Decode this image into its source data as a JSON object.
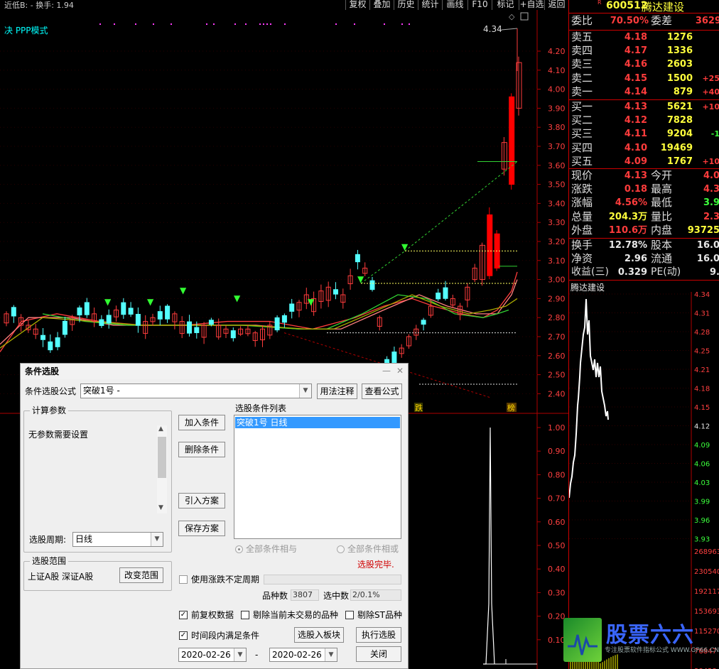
{
  "toolbar": {
    "title_text": "近低B: -  换手: 1.94",
    "mode_text": "决 PPP模式",
    "buttons": [
      "复权",
      "叠加",
      "历史",
      "统计",
      "画线",
      "F10",
      "标记",
      "+自选",
      "返回"
    ]
  },
  "chart_labels": {
    "high_marker": "4.34",
    "price_ticks": [
      "4.20",
      "4.10",
      "4.00",
      "3.90",
      "3.80",
      "3.70",
      "3.60",
      "3.50",
      "3.40",
      "3.30",
      "3.20",
      "3.10",
      "3.00",
      "2.90",
      "2.80",
      "2.70",
      "2.60",
      "2.50",
      "2.40"
    ],
    "volume_ticks": [
      "1.00",
      "0.90",
      "0.80",
      "0.70",
      "0.60",
      "0.50",
      "0.40",
      "0.30",
      "0.20",
      "0.10"
    ],
    "tag_die": "跌",
    "tag_bang": "榜"
  },
  "quote": {
    "stock_code": "600512",
    "stock_name": "腾达建设",
    "r_mark": "R",
    "weibi_label": "委比",
    "weibi_value": "70.50%",
    "weicha_label": "委差",
    "weicha_value": "3629",
    "asks": [
      {
        "label": "卖五",
        "price": "4.18",
        "volume": "1276",
        "change": ""
      },
      {
        "label": "卖四",
        "price": "4.17",
        "volume": "1336",
        "change": ""
      },
      {
        "label": "卖三",
        "price": "4.16",
        "volume": "2603",
        "change": ""
      },
      {
        "label": "卖二",
        "price": "4.15",
        "volume": "1500",
        "change": "+25"
      },
      {
        "label": "卖一",
        "price": "4.14",
        "volume": "879",
        "change": "+40"
      }
    ],
    "bids": [
      {
        "label": "买一",
        "price": "4.13",
        "volume": "5621",
        "change": "+10"
      },
      {
        "label": "买二",
        "price": "4.12",
        "volume": "7828",
        "change": ""
      },
      {
        "label": "买三",
        "price": "4.11",
        "volume": "9204",
        "change": "-1"
      },
      {
        "label": "买四",
        "price": "4.10",
        "volume": "19469",
        "change": ""
      },
      {
        "label": "买五",
        "price": "4.09",
        "volume": "1767",
        "change": "+10"
      }
    ],
    "stats": [
      {
        "l1": "现价",
        "v1": "4.13",
        "l2": "今开",
        "v2": "4.0"
      },
      {
        "l1": "涨跌",
        "v1": "0.18",
        "l2": "最高",
        "v2": "4.3"
      },
      {
        "l1": "涨幅",
        "v1": "4.56%",
        "l2": "最低",
        "v2": "3.9"
      },
      {
        "l1": "总量",
        "v1": "204.3万",
        "l2": "量比",
        "v2": "2.3"
      },
      {
        "l1": "外盘",
        "v1": "110.6万",
        "l2": "内盘",
        "v2": "93725"
      }
    ],
    "stats2": [
      {
        "l1": "换手",
        "v1": "12.78%",
        "l2": "股本",
        "v2": "16.0"
      },
      {
        "l1": "净资",
        "v1": "2.96",
        "l2": "流通",
        "v2": "16.0"
      },
      {
        "l1": "收益(三)",
        "v1": "0.329",
        "l2": "PE(动)",
        "v2": "9."
      }
    ],
    "mini_title": "腾达建设",
    "mini_price_ticks": [
      "4.34",
      "4.31",
      "4.28",
      "4.25",
      "4.21",
      "4.18",
      "4.15",
      "4.12",
      "4.09",
      "4.06",
      "4.03",
      "3.99",
      "3.96",
      "3.93"
    ],
    "mini_volume_ticks": [
      "268963",
      "230540",
      "192117",
      "153693",
      "115270",
      "76847",
      "38423"
    ],
    "watermark_text": "股票六六",
    "watermark_sub": "专注股票软件指标公式 WWW.GP66.CN"
  },
  "dialog": {
    "title": "条件选股",
    "formula_label": "条件选股公式",
    "formula_value": "突破1号          -",
    "usage_btn": "用法注释",
    "view_btn": "查看公式",
    "params_group": "计算参数",
    "params_text": "无参数需要设置",
    "period_label": "选股周期:",
    "period_value": "日线",
    "add_btn": "加入条件",
    "del_btn": "删除条件",
    "import_btn": "引入方案",
    "save_btn": "保存方案",
    "list_title": "选股条件列表",
    "list_item": "突破1号   日线",
    "radio_and": "全部条件相与",
    "radio_or": "全部条件相或",
    "done_text": "选股完毕.",
    "range_group": "选股范围",
    "range_text": "上证A股  深证A股",
    "range_btn": "改变范围",
    "undetermined_label": "使用涨跌不定周期",
    "count_label": "品种数",
    "count_value": "3807",
    "selected_label": "选中数",
    "selected_value": "2/0.1%",
    "fuquan_label": "前复权数据",
    "exclude_label": "剔除当前未交易的品种",
    "exclude_st_label": "剔除ST品种",
    "period_cond_label": "时间段内满足条件",
    "to_block_btn": "选股入板块",
    "run_btn": "执行选股",
    "close_btn": "关闭",
    "date_from": "2020-02-26",
    "date_sep": "-",
    "date_to": "2020-02-26",
    "minimize_icon": "—",
    "close_icon": "✕"
  }
}
